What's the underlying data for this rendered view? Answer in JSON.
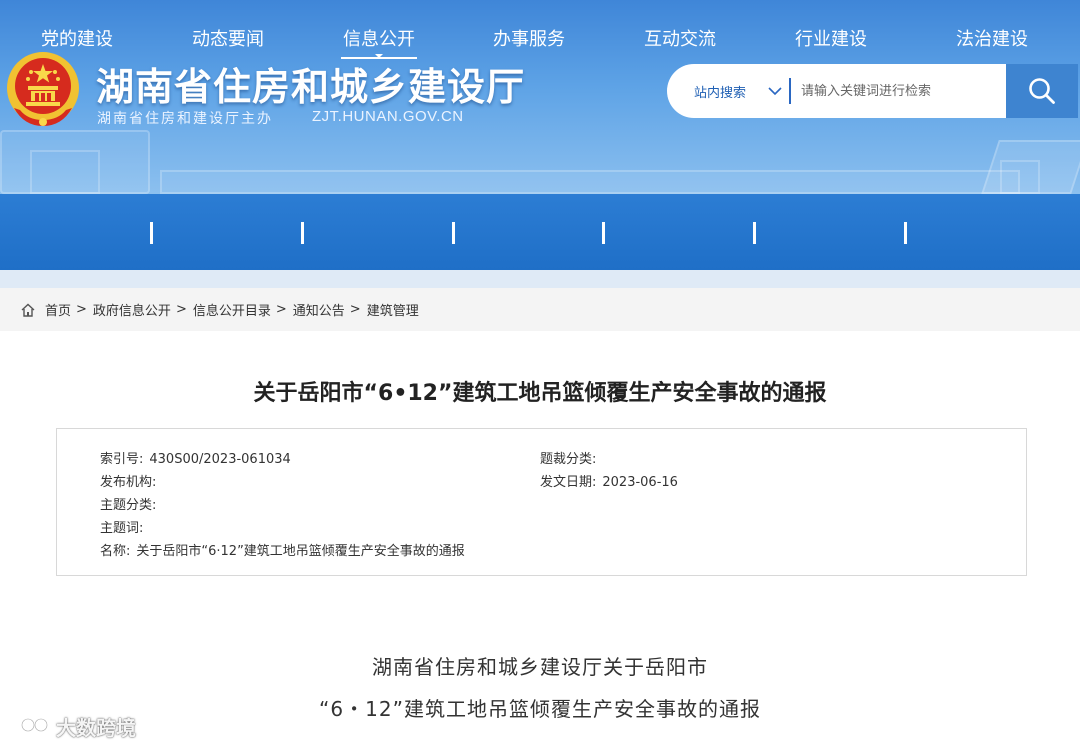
{
  "header": {
    "title": "湖南省住房和城乡建设厅",
    "subtitle": "湖南省住房和建设厅主办",
    "url": "ZJT.HUNAN.GOV.CN"
  },
  "search": {
    "scope_label": "站内搜索",
    "placeholder": "请输入关键词进行检索"
  },
  "nav": {
    "items": [
      {
        "label": "党的建设"
      },
      {
        "label": "动态要闻"
      },
      {
        "label": "信息公开"
      },
      {
        "label": "办事服务"
      },
      {
        "label": "互动交流"
      },
      {
        "label": "行业建设"
      },
      {
        "label": "法治建设"
      }
    ],
    "active_index": 2
  },
  "breadcrumb": {
    "items": [
      "首页",
      "政府信息公开",
      "信息公开目录",
      "通知公告",
      "建筑管理"
    ],
    "separator": ">"
  },
  "article": {
    "title": "关于岳阳市“6•12”建筑工地吊篮倾覆生产安全事故的通报",
    "meta": {
      "index_label": "索引号:",
      "index_value": "430S00/2023-061034",
      "category_label": "题裁分类:",
      "category_value": "",
      "publisher_label": "发布机构:",
      "publisher_value": "",
      "date_label": "发文日期:",
      "date_value": "2023-06-16",
      "topic_label": "主题分类:",
      "topic_value": "",
      "keywords_label": "主题词:",
      "keywords_value": "",
      "name_label": "名称:",
      "name_value": "关于岳阳市“6·12”建筑工地吊篮倾覆生产安全事故的通报"
    },
    "doc_heading_line1": "湖南省住房和城乡建设厅关于岳阳市",
    "doc_heading_line2": "“6・12”建筑工地吊篮倾覆生产安全事故的通报"
  },
  "watermark": {
    "text": "大数跨境"
  },
  "colors": {
    "header_blue": "#3f86d8",
    "nav_blue": "#1f6fc7",
    "search_button": "#3e84d0",
    "link_blue": "#2060b4"
  }
}
